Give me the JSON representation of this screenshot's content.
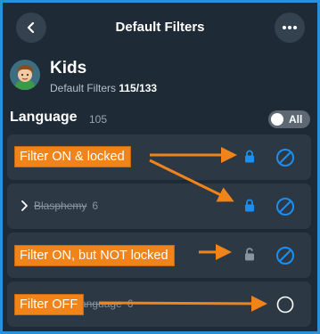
{
  "header": {
    "title": "Default Filters",
    "back_icon": "chevron-left-icon",
    "more_icon": "more-horizontal-icon"
  },
  "profile": {
    "name": "Kids",
    "subtitle_prefix": "Default Filters",
    "filter_count": "115/133",
    "avatar_icon": "kid-avatar-icon"
  },
  "section": {
    "title": "Language",
    "count": "105",
    "toggle_label": "All"
  },
  "rows": [
    {
      "label": "",
      "count": "",
      "state": "on",
      "locked": true
    },
    {
      "label": "Blasphemy",
      "count": "6",
      "state": "on",
      "locked": true
    },
    {
      "label": "",
      "count": "",
      "state": "on",
      "locked": false
    },
    {
      "label": "...anguage",
      "count": "6",
      "state": "off",
      "locked": false
    }
  ],
  "annotations": {
    "callout_1": "Filter ON & locked",
    "callout_2": "Filter ON, but NOT locked",
    "callout_3": "Filter OFF"
  },
  "colors": {
    "frame": "#2a90d8",
    "background": "#1e2a35",
    "row": "#2c3945",
    "accent_blue": "#1b8ff0",
    "callout": "#f0831a"
  }
}
